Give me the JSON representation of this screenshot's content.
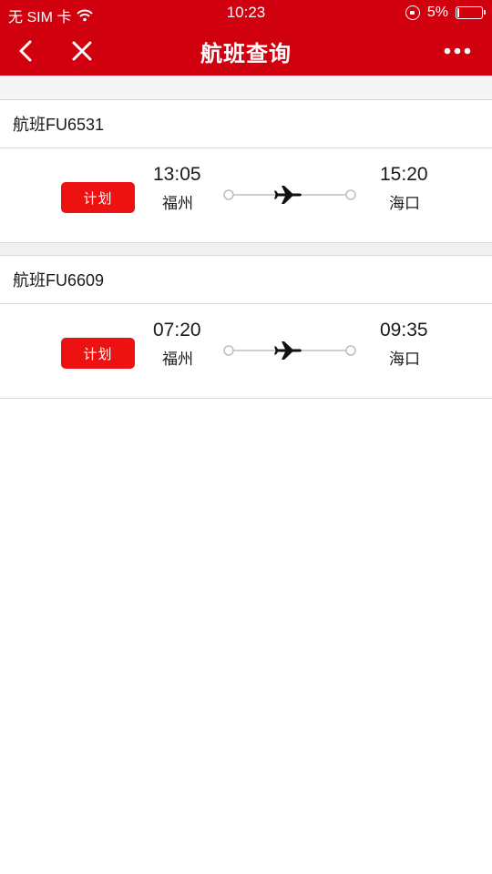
{
  "status_bar": {
    "carrier": "无 SIM 卡",
    "time": "10:23",
    "battery": "5%"
  },
  "nav": {
    "title": "航班查询",
    "icons": [
      "back-icon",
      "close-icon",
      "more-icon"
    ]
  },
  "flights": [
    {
      "flight_label": "航班FU6531",
      "status": "计划",
      "dep_time": "13:05",
      "dep_city": "福州",
      "arr_time": "15:20",
      "arr_city": "海口"
    },
    {
      "flight_label": "航班FU6609",
      "status": "计划",
      "dep_time": "07:20",
      "dep_city": "福州",
      "arr_time": "09:35",
      "arr_city": "海口"
    }
  ],
  "colors": {
    "header_bg": "#d0000e",
    "status_button": "#ee1111"
  }
}
